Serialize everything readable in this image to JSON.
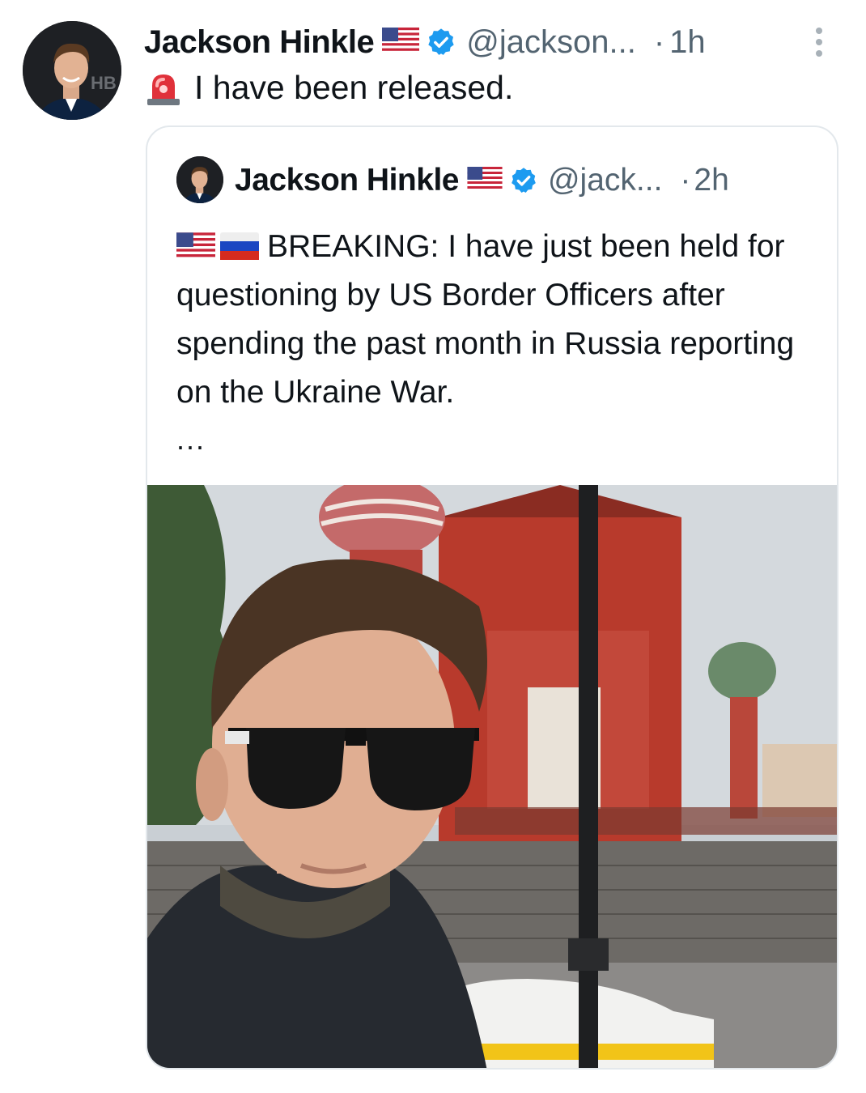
{
  "tweet": {
    "author_name": "Jackson Hinkle",
    "handle": "@jackson...",
    "separator": "·",
    "time": "1h",
    "text": "I have been released.",
    "icons": [
      "us-flag-icon",
      "verified-badge-icon",
      "siren-icon",
      "more-icon"
    ]
  },
  "quoted": {
    "author_name": "Jackson Hinkle",
    "handle": "@jack...",
    "separator": "·",
    "time": "2h",
    "text": "BREAKING: I have just been held for questioning by US Border Officers after spending the past month in Russia reporting on the Ukraine War.",
    "ellipsis": "...",
    "icons": [
      "us-flag-icon",
      "russia-flag-icon",
      "verified-badge-icon"
    ],
    "photo": "selfie-with-sunglasses-in-front-of-st-basils-cathedral"
  },
  "colors": {
    "verified": "#1d9bf0",
    "secondary_text": "#536471",
    "card_border": "#e3e8ec"
  }
}
